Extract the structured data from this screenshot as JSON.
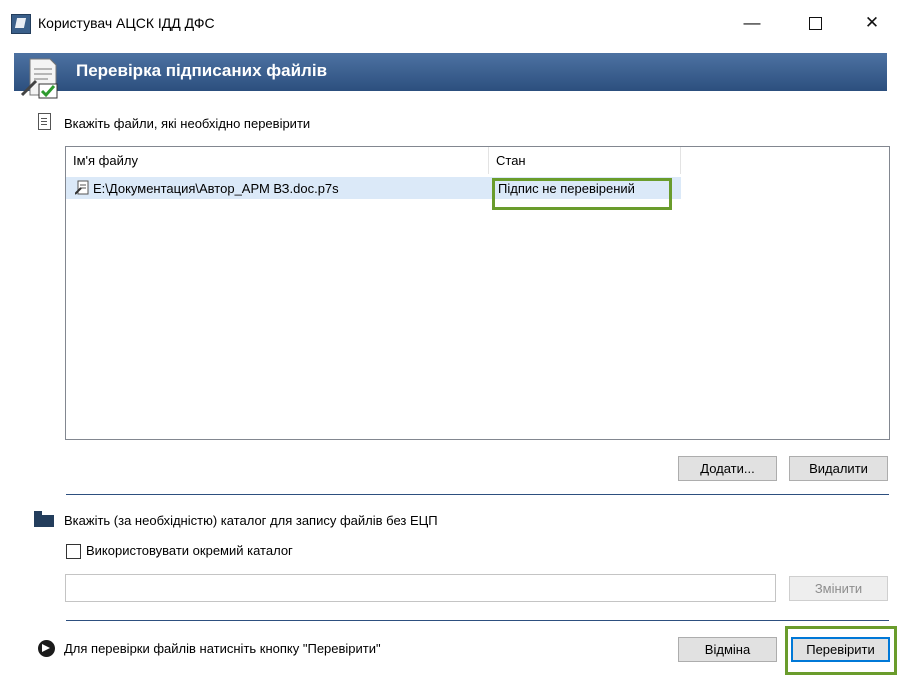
{
  "window": {
    "title": "Користувач АЦСК ІДД ДФС"
  },
  "header": {
    "title": "Перевірка підписаних файлів"
  },
  "files_section": {
    "label": "Вкажіть файли, які необхідно перевірити",
    "columns": [
      "Ім'я файлу",
      "Стан"
    ],
    "rows": [
      {
        "name": "E:\\Документация\\Автор_АРМ ВЗ.doc.p7s",
        "state": "Підпис не перевірений"
      }
    ],
    "add_button": "Додати...",
    "remove_button": "Видалити"
  },
  "catalog_section": {
    "label": "Вкажіть (за необхідністю) каталог для запису файлів без ЕЦП",
    "checkbox_label": "Використовувати окремий каталог",
    "checkbox_checked": false,
    "path_value": "",
    "change_button": "Змінити"
  },
  "footer": {
    "hint": "Для перевірки файлів натисніть кнопку \"Перевірити\"",
    "cancel_button": "Відміна",
    "verify_button": "Перевірити"
  },
  "colors": {
    "header_band": "#2c4f7e",
    "selected_row": "#dbe9f8",
    "highlight_frame": "#6a9c2c",
    "primary_button_border": "#0078d7"
  },
  "icons": [
    "app-icon",
    "signed-document-icon",
    "document-icon",
    "file-signed-icon",
    "folder-open-icon",
    "arrow-right-circle-icon",
    "minimize-icon",
    "maximize-icon",
    "close-icon"
  ]
}
